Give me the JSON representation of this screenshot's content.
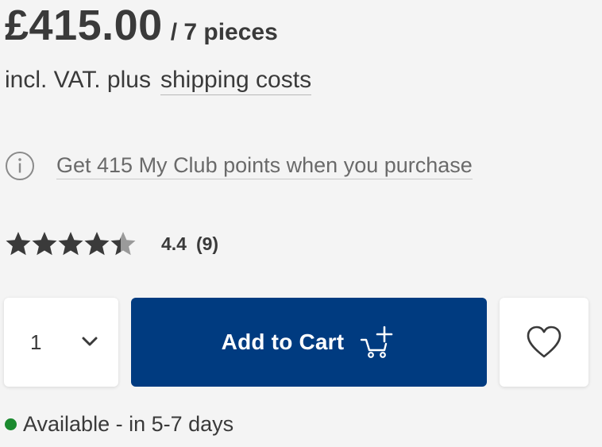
{
  "price": {
    "amount": "£415.00",
    "unit": "/ 7 pieces"
  },
  "vat": {
    "prefix": "incl. VAT. plus",
    "shipping_link": "shipping costs"
  },
  "points": {
    "icon": "info-icon",
    "text": "Get 415 My Club points when you purchase"
  },
  "rating": {
    "value": "4.4",
    "count": "(9)",
    "score": 4.4,
    "max": 5,
    "star_color": "#3a3a3a",
    "empty_color": "#9a9a9a"
  },
  "quantity": {
    "value": "1",
    "icon": "chevron-down-icon"
  },
  "add_to_cart": {
    "label": "Add to Cart",
    "icon": "cart-plus-icon",
    "color": "#003b80"
  },
  "wishlist": {
    "icon": "heart-icon"
  },
  "availability": {
    "text": "Available - in 5-7 days",
    "status_color": "#1b8a2f"
  }
}
